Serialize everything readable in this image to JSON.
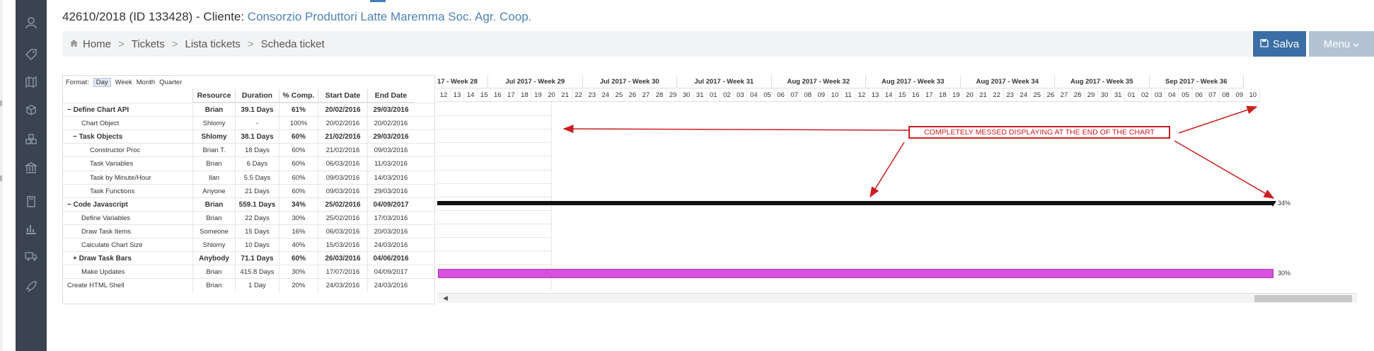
{
  "title": {
    "ticket": "42610/2018 (ID 133428) - Cliente:",
    "client": "Consorzio Produttori Latte Maremma Soc. Agr. Coop."
  },
  "breadcrumb": {
    "home": "Home",
    "tickets": "Tickets",
    "lista": "Lista tickets",
    "scheda": "Scheda ticket",
    "separator": ">"
  },
  "buttons": {
    "save": "Salva",
    "menu": "Menu"
  },
  "sidebar": {
    "icons": [
      "user-icon",
      "tag-icon",
      "map-icon",
      "boxes-icon",
      "cubes-icon",
      "bank-icon",
      "book-icon",
      "bar-chart-icon",
      "truck-icon",
      "rocket-icon"
    ]
  },
  "gantt": {
    "format_label": "Format:",
    "formats": [
      "Day",
      "Week",
      "Month",
      "Quarter"
    ],
    "selected_format": "Day",
    "columns": [
      "Resource",
      "Duration",
      "% Comp.",
      "Start Date",
      "End Date"
    ],
    "rows": [
      {
        "name": "− Define Chart API",
        "resource": "Brian",
        "duration": "39.1 Days",
        "comp": "61%",
        "start": "20/02/2016",
        "end": "29/03/2016",
        "bold": true,
        "indent": 0
      },
      {
        "name": "Chart Object",
        "resource": "Shlomy",
        "duration": "-",
        "comp": "100%",
        "start": "20/02/2016",
        "end": "20/02/2016",
        "bold": false,
        "indent": 1
      },
      {
        "name": "− Task Objects",
        "resource": "Shlomy",
        "duration": "38.1 Days",
        "comp": "60%",
        "start": "21/02/2016",
        "end": "29/03/2016",
        "bold": true,
        "indent": 1
      },
      {
        "name": "Constructor Proc",
        "resource": "Brian T.",
        "duration": "18 Days",
        "comp": "60%",
        "start": "21/02/2016",
        "end": "09/03/2016",
        "bold": false,
        "indent": 2
      },
      {
        "name": "Task Variables",
        "resource": "Brian",
        "duration": "6 Days",
        "comp": "60%",
        "start": "06/03/2016",
        "end": "11/03/2016",
        "bold": false,
        "indent": 2
      },
      {
        "name": "Task by Minute/Hour",
        "resource": "Ilan",
        "duration": "5.5 Days",
        "comp": "60%",
        "start": "09/03/2016",
        "end": "14/03/2016",
        "bold": false,
        "indent": 2
      },
      {
        "name": "Task Functions",
        "resource": "Anyone",
        "duration": "21 Days",
        "comp": "60%",
        "start": "09/03/2016",
        "end": "29/03/2016",
        "bold": false,
        "indent": 2
      },
      {
        "name": "− Code Javascript",
        "resource": "Brian",
        "duration": "559.1 Days",
        "comp": "34%",
        "start": "25/02/2016",
        "end": "04/09/2017",
        "bold": true,
        "indent": 0
      },
      {
        "name": "Define Variables",
        "resource": "Brian",
        "duration": "22 Days",
        "comp": "30%",
        "start": "25/02/2016",
        "end": "17/03/2016",
        "bold": false,
        "indent": 1
      },
      {
        "name": "Draw Task Items",
        "resource": "Someone",
        "duration": "15 Days",
        "comp": "16%",
        "start": "06/03/2016",
        "end": "20/03/2016",
        "bold": false,
        "indent": 1
      },
      {
        "name": "Calculate Chart Size",
        "resource": "Shlomy",
        "duration": "10 Days",
        "comp": "40%",
        "start": "15/03/2016",
        "end": "24/03/2016",
        "bold": false,
        "indent": 1
      },
      {
        "name": "+ Draw Task Bars",
        "resource": "Anybody",
        "duration": "71.1 Days",
        "comp": "60%",
        "start": "26/03/2016",
        "end": "04/06/2016",
        "bold": true,
        "indent": 1
      },
      {
        "name": "Make Updates",
        "resource": "Brian",
        "duration": "415.8 Days",
        "comp": "30%",
        "start": "17/07/2016",
        "end": "04/09/2017",
        "bold": false,
        "indent": 1
      },
      {
        "name": "Create HTML Shell",
        "resource": "Brian",
        "duration": "1 Day",
        "comp": "20%",
        "start": "24/03/2016",
        "end": "24/03/2016",
        "bold": false,
        "indent": 0
      }
    ],
    "weeks": [
      "17 - Week 28",
      "Jul 2017 - Week 29",
      "Jul 2017 - Week 30",
      "Jul 2017 - Week 31",
      "Aug 2017 - Week 32",
      "Aug 2017 - Week 33",
      "Aug 2017 - Week 34",
      "Aug 2017 - Week 35",
      "Sep 2017 - Week 36"
    ],
    "days": [
      "12",
      "13",
      "14",
      "15",
      "16",
      "17",
      "18",
      "19",
      "20",
      "21",
      "22",
      "23",
      "24",
      "25",
      "26",
      "27",
      "28",
      "29",
      "30",
      "31",
      "01",
      "02",
      "03",
      "04",
      "05",
      "06",
      "07",
      "08",
      "09",
      "10",
      "11",
      "12",
      "13",
      "14",
      "15",
      "16",
      "17",
      "18",
      "19",
      "20",
      "21",
      "22",
      "23",
      "24",
      "25",
      "26",
      "27",
      "28",
      "29",
      "30",
      "31",
      "01",
      "02",
      "03",
      "04",
      "05",
      "06",
      "07",
      "08",
      "09",
      "10"
    ],
    "bar_labels": {
      "code_js": "34%",
      "make_updates": "30%"
    },
    "bar_colors": {
      "summary": "#111111",
      "task": "#d94fe0"
    }
  },
  "annotation": {
    "text": "COMPLETELY MESSED DISPLAYING AT THE END OF THE CHART",
    "color": "#cc1f1f"
  }
}
